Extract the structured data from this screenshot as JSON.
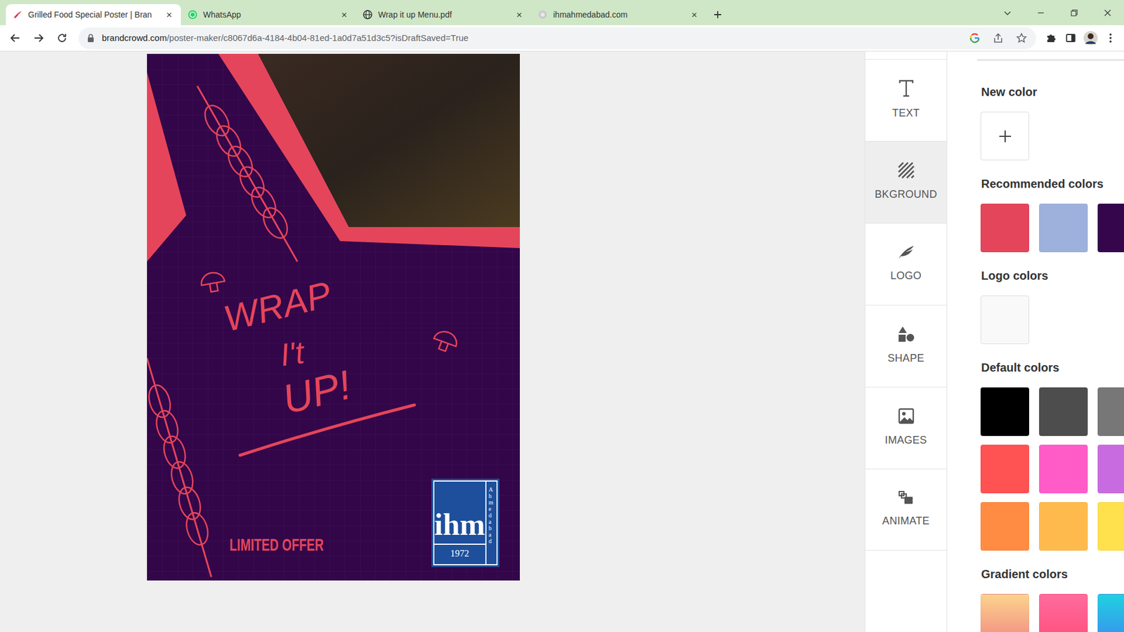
{
  "browser": {
    "tabs": [
      {
        "label": "Grilled Food Special Poster | Bran",
        "close": "×",
        "selected": true,
        "kind": "brandcrowd"
      },
      {
        "label": "WhatsApp",
        "close": "×",
        "selected": false,
        "kind": "whatsapp"
      },
      {
        "label": "Wrap it up Menu.pdf",
        "close": "×",
        "selected": false,
        "kind": "globe"
      },
      {
        "label": "ihmahmedabad.com",
        "close": "×",
        "selected": false,
        "kind": "site"
      }
    ],
    "url_host": "brandcrowd.com",
    "url_path": "/poster-maker/c8067d6a-4184-4b04-81ed-1a0d7a51d3c5?isDraftSaved=True"
  },
  "poster": {
    "headline": [
      "WRAP",
      "I't",
      "UP!"
    ],
    "offer": "LIMITED OFFER",
    "logo": {
      "mark": "ihm",
      "year": "1972",
      "side": "Ahmedabad"
    }
  },
  "toolbar": {
    "items": [
      {
        "label": "TEXT",
        "selected": false,
        "kind": "text"
      },
      {
        "label": "BKGROUND",
        "selected": true,
        "kind": "background"
      },
      {
        "label": "LOGO",
        "selected": false,
        "kind": "logo"
      },
      {
        "label": "SHAPE",
        "selected": false,
        "kind": "shape"
      },
      {
        "label": "IMAGES",
        "selected": false,
        "kind": "images"
      },
      {
        "label": "ANIMATE",
        "selected": false,
        "kind": "animate"
      }
    ]
  },
  "panel": {
    "sections": [
      {
        "title": "New color",
        "kind": "add",
        "swatches": []
      },
      {
        "title": "Recommended colors",
        "kind": "solid",
        "swatches": [
          {
            "color": "#e5455a"
          },
          {
            "color": "#9eb1dc"
          },
          {
            "color": "#36064d"
          }
        ]
      },
      {
        "title": "Logo colors",
        "kind": "solid",
        "swatches": [
          {
            "color": "#f9f9f9"
          }
        ]
      },
      {
        "title": "Default colors",
        "kind": "solid",
        "swatches": [
          {
            "color": "#000000"
          },
          {
            "color": "#4d4d4d"
          },
          {
            "color": "#777777"
          },
          {
            "color": "#ff5252"
          },
          {
            "color": "#ff5cc8"
          },
          {
            "color": "#c86be0"
          },
          {
            "color": "#ff8c42"
          },
          {
            "color": "#ffba4d"
          },
          {
            "color": "#ffe04d"
          }
        ]
      },
      {
        "title": "Gradient colors",
        "kind": "gradient",
        "swatches": [
          {
            "color": "#fbd38d",
            "color2": "#f28b82"
          },
          {
            "color": "#ff6b9d",
            "color2": "#ff4f7b"
          },
          {
            "color": "#1fd1e0",
            "color2": "#3a8ef0"
          }
        ]
      }
    ]
  }
}
